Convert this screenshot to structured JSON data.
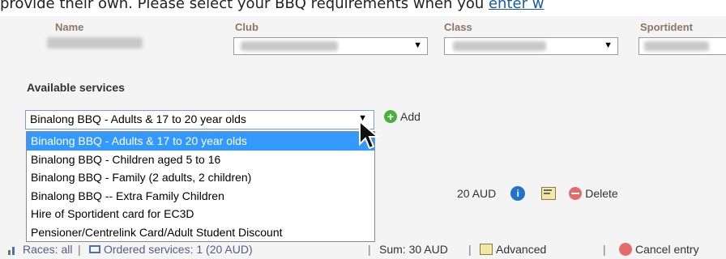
{
  "top_text": {
    "prefix": "provide their own. Please select your BBQ requirements when you ",
    "link": "enter w"
  },
  "table_headers": {
    "name": "Name",
    "club": "Club",
    "class": "Class",
    "sportident": "Sportident"
  },
  "services": {
    "title": "Available services",
    "selected_value": "Binalong BBQ - Adults & 17 to 20 year olds",
    "add_label": "Add",
    "options": [
      "Binalong BBQ - Adults & 17 to 20 year olds",
      "Binalong BBQ - Children aged 5 to 16",
      "Binalong BBQ - Family (2 adults, 2 children)",
      "Binalong BBQ -- Extra Family Children",
      "Hire of Sportident card for EC3D",
      "Pensioner/Centrelink Card/Adult Student Discount"
    ]
  },
  "service_row": {
    "price": "20 AUD",
    "delete_label": "Delete"
  },
  "bottom_bar": {
    "races": "Races: all",
    "ordered": "Ordered services: 1 (20 AUD)",
    "sum": "Sum: 30 AUD",
    "advanced": "Advanced",
    "cancel": "Cancel entry"
  },
  "colors": {
    "highlight": "#3399ff",
    "link": "#1a5aa8",
    "add_green": "#4cae3e",
    "info_blue": "#1f73c9",
    "delete_red": "#e46b6b"
  }
}
